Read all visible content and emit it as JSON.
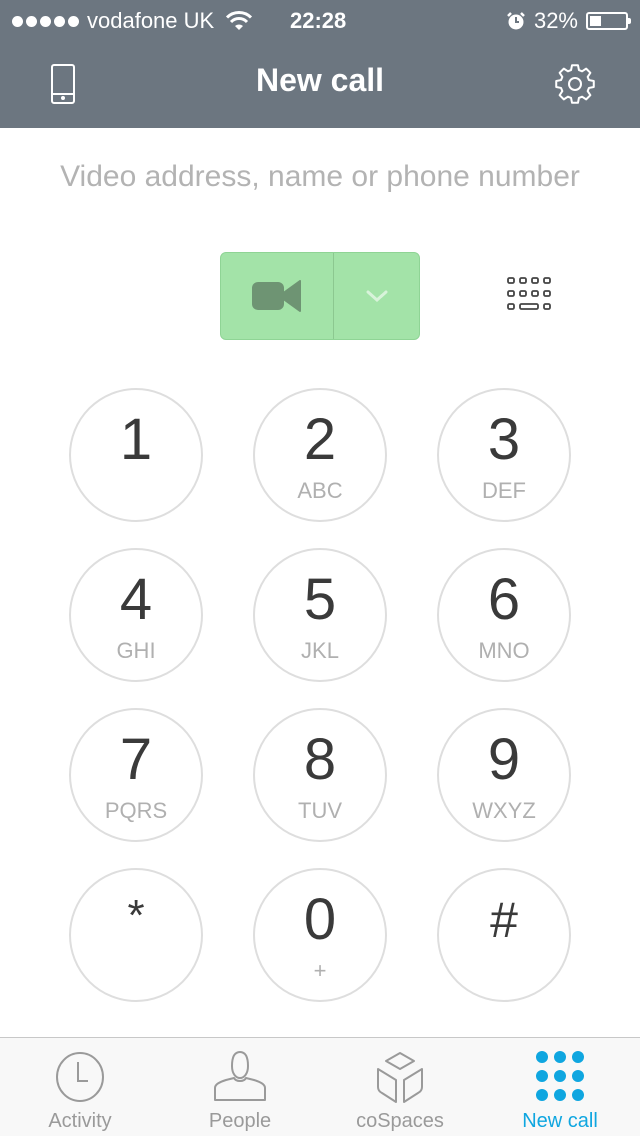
{
  "status_bar": {
    "signal_dots": 5,
    "carrier": "vodafone UK",
    "time": "22:28",
    "battery_percent_label": "32%",
    "battery_level": 0.32
  },
  "header": {
    "title": "New call",
    "left_icon": "mobile-phone-icon",
    "right_icon": "gear-icon"
  },
  "address_input": {
    "value": "",
    "placeholder": "Video address, name or phone number"
  },
  "call_button": {
    "icon": "video-camera-icon",
    "dropdown_icon": "chevron-down-icon",
    "color": "#a3e3a8"
  },
  "keypad_toggle_icon": "keyboard-icon",
  "keypad": [
    {
      "digit": "1",
      "letters": ""
    },
    {
      "digit": "2",
      "letters": "ABC"
    },
    {
      "digit": "3",
      "letters": "DEF"
    },
    {
      "digit": "4",
      "letters": "GHI"
    },
    {
      "digit": "5",
      "letters": "JKL"
    },
    {
      "digit": "6",
      "letters": "MNO"
    },
    {
      "digit": "7",
      "letters": "PQRS"
    },
    {
      "digit": "8",
      "letters": "TUV"
    },
    {
      "digit": "9",
      "letters": "WXYZ"
    },
    {
      "digit": "*",
      "letters": ""
    },
    {
      "digit": "0",
      "letters": "+"
    },
    {
      "digit": "#",
      "letters": ""
    }
  ],
  "tabs": [
    {
      "label": "Activity",
      "icon": "clock-icon",
      "active": false
    },
    {
      "label": "People",
      "icon": "person-icon",
      "active": false
    },
    {
      "label": "coSpaces",
      "icon": "cube-icon",
      "active": false
    },
    {
      "label": "New call",
      "icon": "dialpad-icon",
      "active": true
    }
  ],
  "colors": {
    "header_bg": "#6c7680",
    "accent": "#0fa6e0",
    "inactive_tab": "#9a9a9a"
  }
}
